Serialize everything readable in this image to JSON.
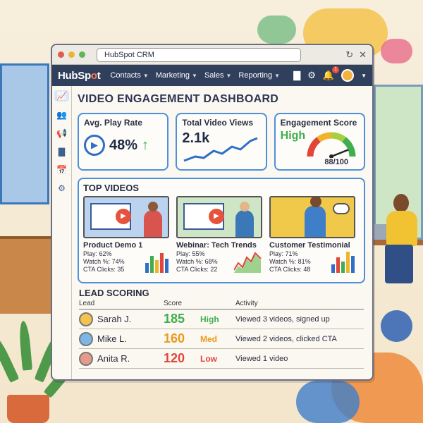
{
  "browser": {
    "tab_title": "HubSpot CRM"
  },
  "nav": {
    "logo_text_a": "HubSp",
    "logo_text_o": "o",
    "logo_text_b": "t",
    "items": [
      {
        "label": "Contacts"
      },
      {
        "label": "Marketing"
      },
      {
        "label": "Sales"
      },
      {
        "label": "Reporting"
      }
    ],
    "notification_count": "1"
  },
  "sidebar": {
    "items": [
      "dashboard-icon",
      "contacts-icon",
      "megaphone-icon",
      "reports-icon",
      "calendar-icon",
      "settings-icon"
    ]
  },
  "dashboard": {
    "title": "VIDEO ENGAGEMENT DASHBOARD",
    "kpis": {
      "play_rate": {
        "label": "Avg. Play Rate",
        "value": "48%"
      },
      "views": {
        "label": "Total Video Views",
        "value": "2.1k"
      },
      "engagement": {
        "label": "Engagement Score",
        "tier": "High",
        "score": "88/100",
        "score_fraction": 0.88
      }
    }
  },
  "top_videos": {
    "title": "TOP VIDEOS",
    "items": [
      {
        "title": "Product Demo 1",
        "play": "Play: 62%",
        "watch": "Watch %: 74%",
        "cta": "CTA Clicks: 35",
        "chart": "bar"
      },
      {
        "title": "Webinar: Tech Trends",
        "play": "Play: 55%",
        "watch": "Watch %: 68%",
        "cta": "CTA Clicks: 22",
        "chart": "area"
      },
      {
        "title": "Customer Testimonial",
        "play": "Play: 71%",
        "watch": "Watch %: 81%",
        "cta": "CTA Clicks: 48",
        "chart": "bar"
      }
    ]
  },
  "lead_scoring": {
    "title": "LEAD SCORING",
    "headers": {
      "lead": "Lead",
      "score": "Score",
      "activity": "Activity"
    },
    "rows": [
      {
        "name": "Sarah J.",
        "score": "185",
        "tier": "High",
        "tier_color": "#3fae4f",
        "activity": "Viewed 3 videos, signed up"
      },
      {
        "name": "Mike L.",
        "score": "160",
        "tier": "Med",
        "tier_color": "#e69b1f",
        "activity": "Viewed 2 videos, clicked CTA"
      },
      {
        "name": "Anita R.",
        "score": "120",
        "tier": "Low",
        "tier_color": "#e0463a",
        "activity": "Viewed 1 video"
      }
    ]
  },
  "colors": {
    "nav_bg": "#2f3f5c",
    "accent_blue": "#4f8fd8",
    "brand_orange": "#ff7a59"
  }
}
